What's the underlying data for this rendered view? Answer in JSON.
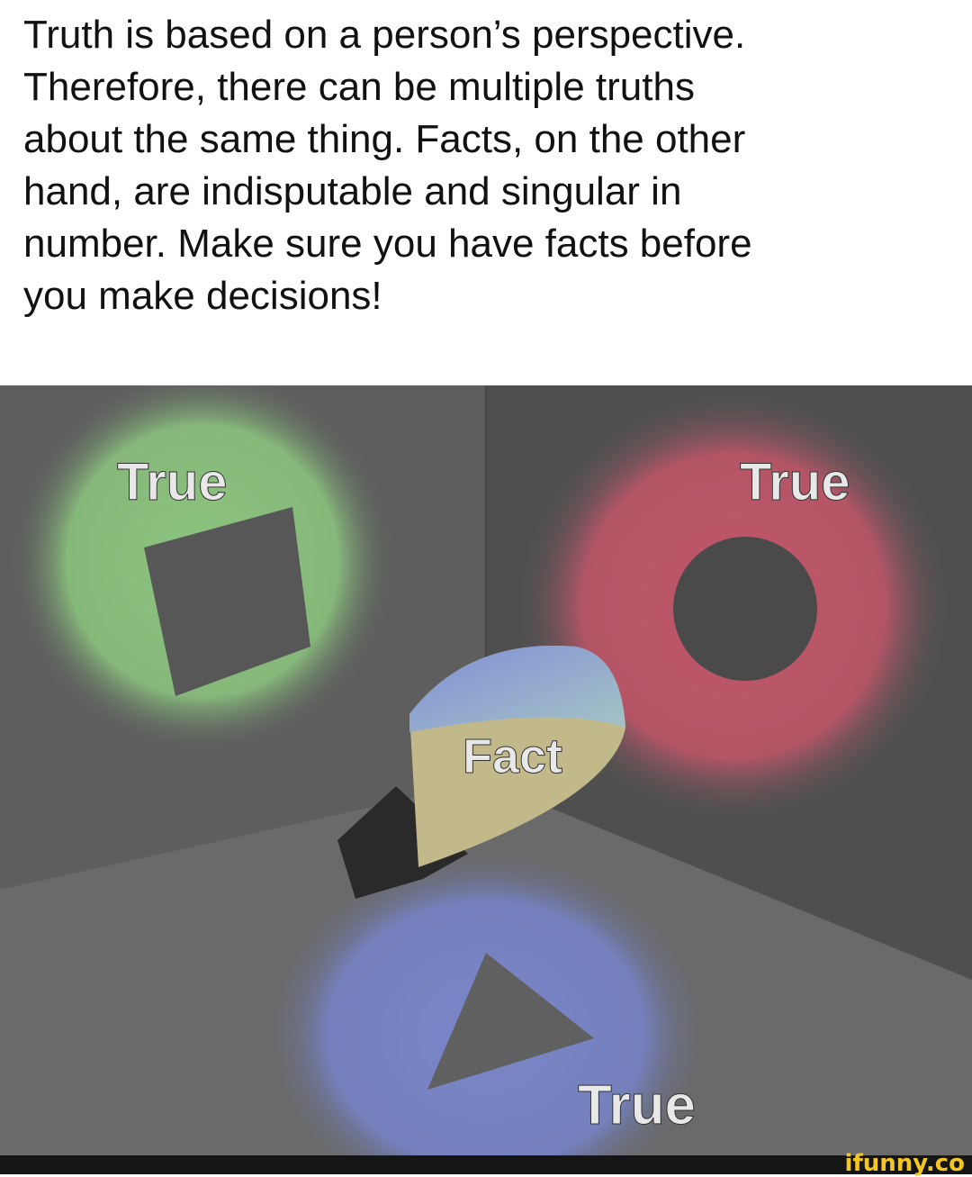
{
  "caption": {
    "lines": [
      "Truth is based on a person’s perspective.",
      "Therefore, there can be multiple truths",
      "about the same thing.  Facts, on the other",
      "hand, are indisputable and singular in",
      "number.  Make sure you have facts before",
      "you make decisions!"
    ]
  },
  "scene": {
    "labels": {
      "green": "True",
      "red": "True",
      "blue": "True",
      "object": "Fact"
    },
    "colors": {
      "green": "#8cc47e",
      "red": "#c0576a",
      "blue": "#7a86c8",
      "wall": "#5f5f5f",
      "object_top": "#8a9bd6",
      "object_front": "#c2b98a"
    }
  },
  "watermark": "ifunny.co"
}
